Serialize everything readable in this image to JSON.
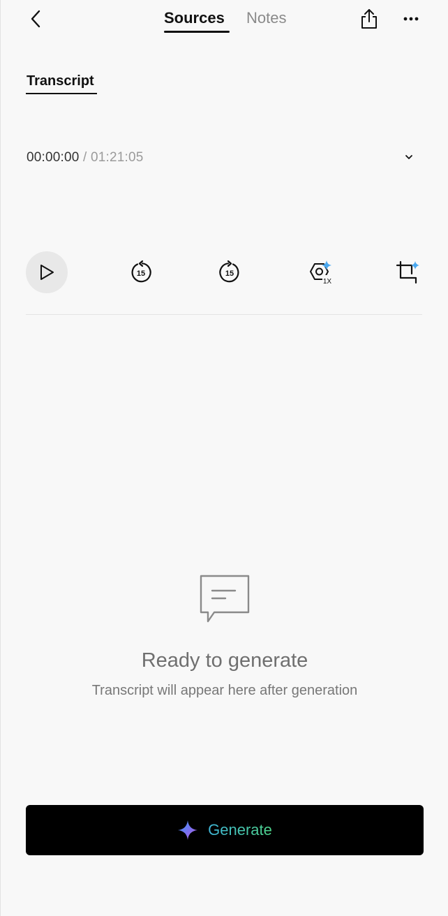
{
  "header": {
    "tabs": [
      {
        "label": "Sources",
        "active": true
      },
      {
        "label": "Notes",
        "active": false
      }
    ],
    "back_icon": "chevron-left-icon",
    "share_icon": "share-icon",
    "more_icon": "more-horizontal-icon"
  },
  "subtab": {
    "label": "Transcript"
  },
  "player": {
    "current_time": "00:00:00",
    "separator": " / ",
    "total_time": "01:21:05",
    "controls": [
      {
        "name": "play",
        "icon": "play-icon"
      },
      {
        "name": "rewind-15",
        "icon": "rewind-15-icon"
      },
      {
        "name": "forward-15",
        "icon": "forward-15-icon"
      },
      {
        "name": "speed",
        "icon": "speed-icon",
        "label": "1X"
      },
      {
        "name": "crop",
        "icon": "crop-icon"
      }
    ]
  },
  "empty_state": {
    "icon": "message-icon",
    "title": "Ready to generate",
    "subtitle": "Transcript will appear here after generation"
  },
  "generate_button": {
    "label": "Generate",
    "icon": "sparkle-icon"
  },
  "colors": {
    "background": "#f8f8f8",
    "text_primary": "#111111",
    "text_muted": "#8a8a8a",
    "button_bg": "#000000",
    "sparkle_blue": "#4aa8f0",
    "gradient_start": "#3fb6d9",
    "gradient_end": "#4ed48a"
  }
}
